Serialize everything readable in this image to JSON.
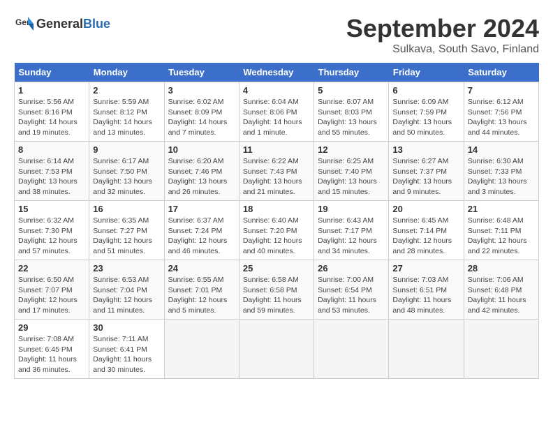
{
  "header": {
    "logo_general": "General",
    "logo_blue": "Blue",
    "month_title": "September 2024",
    "subtitle": "Sulkava, South Savo, Finland"
  },
  "days_of_week": [
    "Sunday",
    "Monday",
    "Tuesday",
    "Wednesday",
    "Thursday",
    "Friday",
    "Saturday"
  ],
  "weeks": [
    [
      {
        "day": "1",
        "info": "Sunrise: 5:56 AM\nSunset: 8:16 PM\nDaylight: 14 hours\nand 19 minutes."
      },
      {
        "day": "2",
        "info": "Sunrise: 5:59 AM\nSunset: 8:12 PM\nDaylight: 14 hours\nand 13 minutes."
      },
      {
        "day": "3",
        "info": "Sunrise: 6:02 AM\nSunset: 8:09 PM\nDaylight: 14 hours\nand 7 minutes."
      },
      {
        "day": "4",
        "info": "Sunrise: 6:04 AM\nSunset: 8:06 PM\nDaylight: 14 hours\nand 1 minute."
      },
      {
        "day": "5",
        "info": "Sunrise: 6:07 AM\nSunset: 8:03 PM\nDaylight: 13 hours\nand 55 minutes."
      },
      {
        "day": "6",
        "info": "Sunrise: 6:09 AM\nSunset: 7:59 PM\nDaylight: 13 hours\nand 50 minutes."
      },
      {
        "day": "7",
        "info": "Sunrise: 6:12 AM\nSunset: 7:56 PM\nDaylight: 13 hours\nand 44 minutes."
      }
    ],
    [
      {
        "day": "8",
        "info": "Sunrise: 6:14 AM\nSunset: 7:53 PM\nDaylight: 13 hours\nand 38 minutes."
      },
      {
        "day": "9",
        "info": "Sunrise: 6:17 AM\nSunset: 7:50 PM\nDaylight: 13 hours\nand 32 minutes."
      },
      {
        "day": "10",
        "info": "Sunrise: 6:20 AM\nSunset: 7:46 PM\nDaylight: 13 hours\nand 26 minutes."
      },
      {
        "day": "11",
        "info": "Sunrise: 6:22 AM\nSunset: 7:43 PM\nDaylight: 13 hours\nand 21 minutes."
      },
      {
        "day": "12",
        "info": "Sunrise: 6:25 AM\nSunset: 7:40 PM\nDaylight: 13 hours\nand 15 minutes."
      },
      {
        "day": "13",
        "info": "Sunrise: 6:27 AM\nSunset: 7:37 PM\nDaylight: 13 hours\nand 9 minutes."
      },
      {
        "day": "14",
        "info": "Sunrise: 6:30 AM\nSunset: 7:33 PM\nDaylight: 13 hours\nand 3 minutes."
      }
    ],
    [
      {
        "day": "15",
        "info": "Sunrise: 6:32 AM\nSunset: 7:30 PM\nDaylight: 12 hours\nand 57 minutes."
      },
      {
        "day": "16",
        "info": "Sunrise: 6:35 AM\nSunset: 7:27 PM\nDaylight: 12 hours\nand 51 minutes."
      },
      {
        "day": "17",
        "info": "Sunrise: 6:37 AM\nSunset: 7:24 PM\nDaylight: 12 hours\nand 46 minutes."
      },
      {
        "day": "18",
        "info": "Sunrise: 6:40 AM\nSunset: 7:20 PM\nDaylight: 12 hours\nand 40 minutes."
      },
      {
        "day": "19",
        "info": "Sunrise: 6:43 AM\nSunset: 7:17 PM\nDaylight: 12 hours\nand 34 minutes."
      },
      {
        "day": "20",
        "info": "Sunrise: 6:45 AM\nSunset: 7:14 PM\nDaylight: 12 hours\nand 28 minutes."
      },
      {
        "day": "21",
        "info": "Sunrise: 6:48 AM\nSunset: 7:11 PM\nDaylight: 12 hours\nand 22 minutes."
      }
    ],
    [
      {
        "day": "22",
        "info": "Sunrise: 6:50 AM\nSunset: 7:07 PM\nDaylight: 12 hours\nand 17 minutes."
      },
      {
        "day": "23",
        "info": "Sunrise: 6:53 AM\nSunset: 7:04 PM\nDaylight: 12 hours\nand 11 minutes."
      },
      {
        "day": "24",
        "info": "Sunrise: 6:55 AM\nSunset: 7:01 PM\nDaylight: 12 hours\nand 5 minutes."
      },
      {
        "day": "25",
        "info": "Sunrise: 6:58 AM\nSunset: 6:58 PM\nDaylight: 11 hours\nand 59 minutes."
      },
      {
        "day": "26",
        "info": "Sunrise: 7:00 AM\nSunset: 6:54 PM\nDaylight: 11 hours\nand 53 minutes."
      },
      {
        "day": "27",
        "info": "Sunrise: 7:03 AM\nSunset: 6:51 PM\nDaylight: 11 hours\nand 48 minutes."
      },
      {
        "day": "28",
        "info": "Sunrise: 7:06 AM\nSunset: 6:48 PM\nDaylight: 11 hours\nand 42 minutes."
      }
    ],
    [
      {
        "day": "29",
        "info": "Sunrise: 7:08 AM\nSunset: 6:45 PM\nDaylight: 11 hours\nand 36 minutes."
      },
      {
        "day": "30",
        "info": "Sunrise: 7:11 AM\nSunset: 6:41 PM\nDaylight: 11 hours\nand 30 minutes."
      },
      {
        "day": "",
        "info": ""
      },
      {
        "day": "",
        "info": ""
      },
      {
        "day": "",
        "info": ""
      },
      {
        "day": "",
        "info": ""
      },
      {
        "day": "",
        "info": ""
      }
    ]
  ]
}
